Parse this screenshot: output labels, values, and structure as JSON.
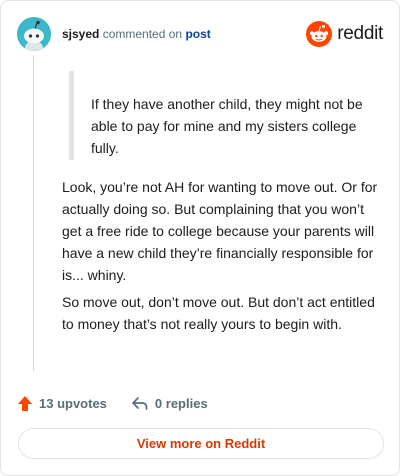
{
  "header": {
    "username": "sjsyed",
    "action_text": "commented on",
    "post_link": "post",
    "brand": "reddit"
  },
  "comment": {
    "quote": "If they have another child, they might not be able to pay for mine and my sisters college fully.",
    "paragraphs": [
      "Look, you’re not AH for wanting to move out. Or for actually doing so. But complaining that you won’t get a free ride to college because your parents will have a new child they’re financially responsible for is... whiny.",
      "So move out, don’t move out. But don’t act entitled to money that’s not really yours to begin with."
    ]
  },
  "footer": {
    "upvotes": "13 upvotes",
    "replies": "0 replies",
    "view_more": "View more on Reddit"
  },
  "colors": {
    "accent": "#ff4500",
    "link": "#0a449b",
    "muted": "#576f76",
    "view_more_text": "#d93a00",
    "avatar_bg": "#3bb8c9"
  },
  "icons": {
    "avatar": "snoo-avatar",
    "logo": "reddit-snoo-logo",
    "upvote": "upvote-arrow-icon",
    "reply": "reply-arrow-icon"
  }
}
